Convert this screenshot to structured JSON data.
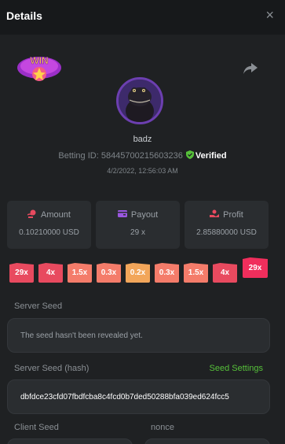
{
  "header": {
    "title": "Details",
    "close": "×"
  },
  "badge": {
    "text": "WIN"
  },
  "user": {
    "name": "badz",
    "betting_id_label": "Betting ID:",
    "betting_id": "58445700215603236",
    "verified": "Verified",
    "datetime": "4/2/2022, 12:56:03 AM"
  },
  "stats": {
    "amount": {
      "label": "Amount",
      "value": "0.10210000 USD"
    },
    "payout": {
      "label": "Payout",
      "value": "29 x"
    },
    "profit": {
      "label": "Profit",
      "value": "2.85880000 USD"
    }
  },
  "multipliers": [
    "29x",
    "4x",
    "1.5x",
    "0.3x",
    "0.2x",
    "0.3x",
    "1.5x",
    "4x",
    "29x"
  ],
  "server_seed": {
    "label": "Server Seed",
    "value": "The seed hasn't been revealed yet."
  },
  "server_seed_hash": {
    "label": "Server Seed (hash)",
    "settings_link": "Seed Settings",
    "value": "dbfdce23cfd07fbdfcba8c4fcd0b7ded50288bfa039ed624fcc5"
  },
  "client_seed": {
    "label": "Client Seed"
  },
  "nonce": {
    "label": "nonce"
  },
  "colors": {
    "accent_green": "#56c03a",
    "background": "#1f2123",
    "panel": "#2a2d30"
  }
}
